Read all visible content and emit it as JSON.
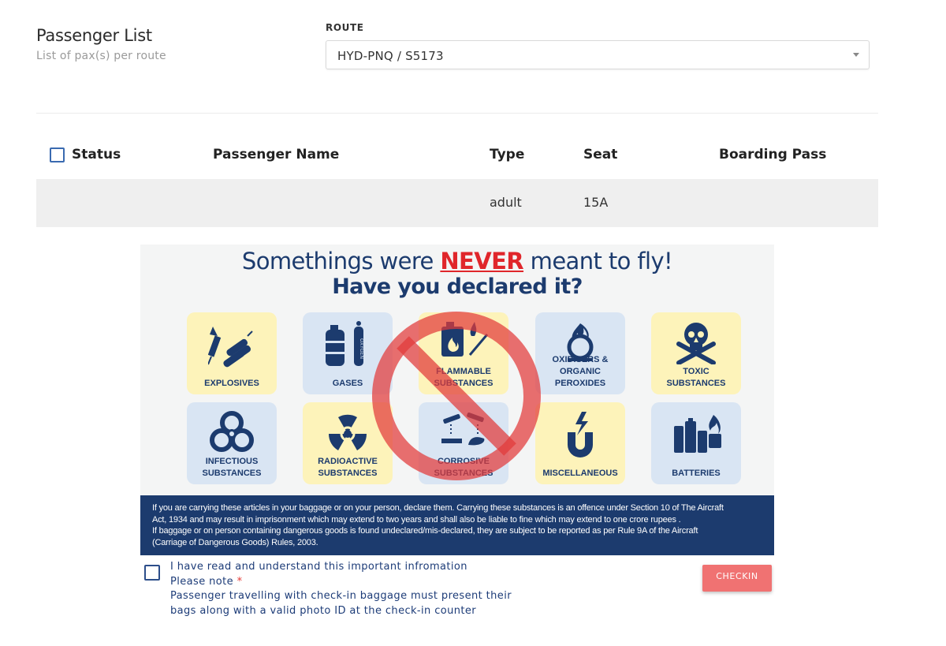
{
  "header": {
    "title": "Passenger List",
    "subtitle": "List of pax(s) per route"
  },
  "route": {
    "label": "ROUTE",
    "selected": "HYD-PNQ / S5173"
  },
  "table": {
    "columns": [
      "Status",
      "Passenger Name",
      "Type",
      "Seat",
      "Boarding Pass"
    ],
    "rows": [
      {
        "status": "",
        "name": "",
        "type": "adult",
        "seat": "15A",
        "boarding_pass": ""
      }
    ]
  },
  "poster": {
    "headline_pre": "Somethings were ",
    "headline_em": "NEVER",
    "headline_post": " meant to fly!",
    "subheadline": "Have you declared it?",
    "categories": [
      {
        "line1": "",
        "line2": "EXPLOSIVES",
        "icon": "firework-dynamite-icon",
        "tone": "#fdf3ba"
      },
      {
        "line1": "",
        "line2": "GASES",
        "icon": "gas-cylinder-icon",
        "tone": "#d9e5f3"
      },
      {
        "line1": "FLAMMABLE",
        "line2": "SUBSTANCES",
        "icon": "flammable-icon",
        "tone": "#fdf3ba"
      },
      {
        "line1": "OXIDISERS &",
        "line2": "ORGANIC PEROXIDES",
        "icon": "oxidiser-icon",
        "tone": "#d9e5f3"
      },
      {
        "line1": "TOXIC",
        "line2": "SUBSTANCES",
        "icon": "skull-crossbones-icon",
        "tone": "#fdf3ba"
      },
      {
        "line1": "INFECTIOUS",
        "line2": "SUBSTANCES",
        "icon": "biohazard-icon",
        "tone": "#d9e5f3"
      },
      {
        "line1": "RADIOACTIVE",
        "line2": "SUBSTANCES",
        "icon": "radiation-icon",
        "tone": "#fdf3ba"
      },
      {
        "line1": "CORROSIVE",
        "line2": "SUBSTANCES",
        "icon": "corrosive-icon",
        "tone": "#d9e5f3"
      },
      {
        "line1": "",
        "line2": "MISCELLANEOUS",
        "icon": "magnet-icon",
        "tone": "#fdf3ba"
      },
      {
        "line1": "",
        "line2": "BATTERIES",
        "icon": "battery-icon",
        "tone": "#d9e5f3"
      }
    ],
    "footer_lines": [
      "If you are carrying these articles in your baggage or on your person, declare them. Carrying these substances is an offence under Section 10 of The Aircraft",
      "Act, 1934 and may result in imprisonment which may extend to two years and shall also be liable to fine which may extend to one crore rupees .",
      "If baggage or on person containing dangerous goods is found undeclared/mis-declared, they are subject to be reported as per Rule 9A of the Aircraft",
      "(Carriage of Dangerous Goods) Rules, 2003."
    ]
  },
  "acknowledgement": {
    "checkbox_label": "I have read and understand this important infromation",
    "note_label": "Please note",
    "required_mark": "*",
    "note_line1": "Passenger travelling with check-in baggage must present their",
    "note_line2": "bags along with a valid photo ID at the check-in counter"
  },
  "actions": {
    "checkin_label": "CHECKIN"
  },
  "colors": {
    "navy": "#1c3b6e",
    "accent_red": "#e0262b",
    "checkin_button": "#f07272",
    "tile_yellow": "#fdf3ba",
    "tile_blue": "#d9e5f3"
  }
}
